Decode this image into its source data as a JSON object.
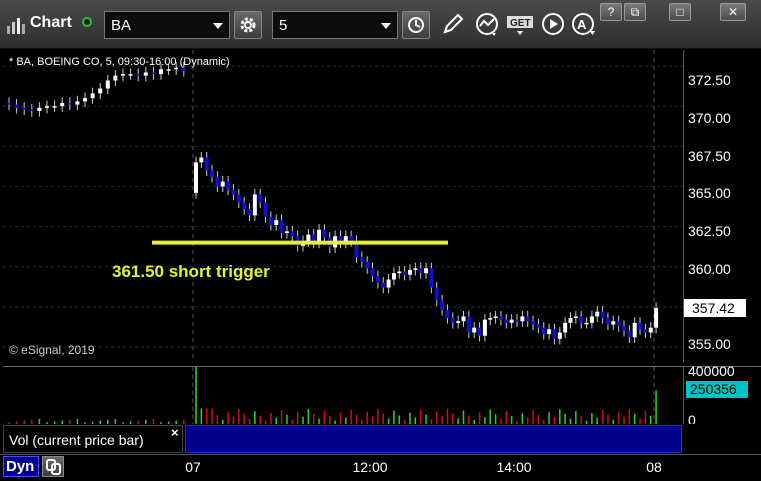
{
  "toolbar": {
    "title": "Chart",
    "symbol": "BA",
    "interval": "5",
    "icons": [
      "clock-icon",
      "pencil-icon",
      "study-icon",
      "get-icon",
      "play-icon",
      "alert-icon"
    ],
    "window_buttons": [
      "?",
      "⧉",
      "□",
      "✕"
    ]
  },
  "chart": {
    "title": "* BA, BOEING CO, 5, 09:30-16:00 (Dynamic)",
    "watermark": "© eSignal, 2019",
    "annotation": "361.50 short trigger",
    "price_labels": [
      "372.50",
      "370.00",
      "367.50",
      "365.00",
      "362.50",
      "360.00",
      "355.00"
    ],
    "last_price": "357.42",
    "trigger_price": 361.5,
    "colors": {
      "up": "#ffffff",
      "down": "#1010d0",
      "trigger": "#e6f22b",
      "vol_up": "#2bd42b",
      "vol_down": "#d01010"
    }
  },
  "volume": {
    "label": "Vol (current price bar)",
    "close": "×",
    "max_label": "400000",
    "last_value": "250356",
    "zero_label": "0"
  },
  "time_axis": {
    "labels": [
      "07",
      "12:00",
      "14:00",
      "08"
    ],
    "dyn": "Dyn"
  },
  "chart_data": {
    "type": "candlestick",
    "title": "* BA, BOEING CO, 5, 09:30-16:00 (Dynamic)",
    "ylim": [
      354,
      373.5
    ],
    "y_ticks": [
      355,
      357.5,
      360,
      362.5,
      365,
      367.5,
      370,
      372.5
    ],
    "x_ticks": [
      "07",
      "12:00",
      "14:00",
      "08"
    ],
    "last_price": 357.42,
    "annotation": {
      "text": "361.50 short trigger",
      "price": 361.5
    },
    "day1_approx_closes": [
      370.1,
      369.9,
      369.8,
      369.7,
      369.9,
      370.0,
      370.0,
      370.2,
      370.1,
      370.3,
      370.5,
      370.8,
      371.1,
      371.6,
      371.9,
      372.0,
      372.0,
      371.9,
      372.1,
      372.0,
      372.3,
      372.3,
      372.4,
      372.2
    ],
    "day2_approx_closes": [
      366.5,
      366.8,
      366.0,
      365.6,
      365.0,
      365.3,
      364.8,
      364.5,
      364.0,
      363.6,
      363.2,
      364.5,
      364.0,
      363.1,
      362.6,
      362.9,
      362.1,
      362.2,
      361.9,
      361.3,
      361.6,
      362.0,
      361.5,
      362.3,
      361.8,
      361.2,
      361.9,
      361.5,
      361.9,
      361.6,
      360.6,
      360.3,
      359.9,
      359.4,
      359.0,
      358.7,
      359.2,
      359.6,
      359.7,
      359.5,
      359.8,
      359.9,
      359.6,
      359.9,
      358.7,
      357.9,
      357.3,
      356.8,
      356.5,
      356.6,
      356.9,
      355.9,
      356.2,
      355.7,
      356.7,
      356.8,
      356.9,
      356.7,
      356.5,
      356.7,
      356.6,
      356.9,
      356.6,
      356.4,
      356.2,
      355.8,
      356.1,
      355.5,
      355.9,
      356.5,
      356.8,
      356.9,
      356.5,
      356.5,
      356.9,
      357.2,
      356.8,
      356.4,
      356.6,
      356.3,
      356.0,
      355.6,
      356.5,
      356.1,
      355.9,
      356.2,
      357.42
    ],
    "volume_max": 400000,
    "volume_last": 250356
  }
}
